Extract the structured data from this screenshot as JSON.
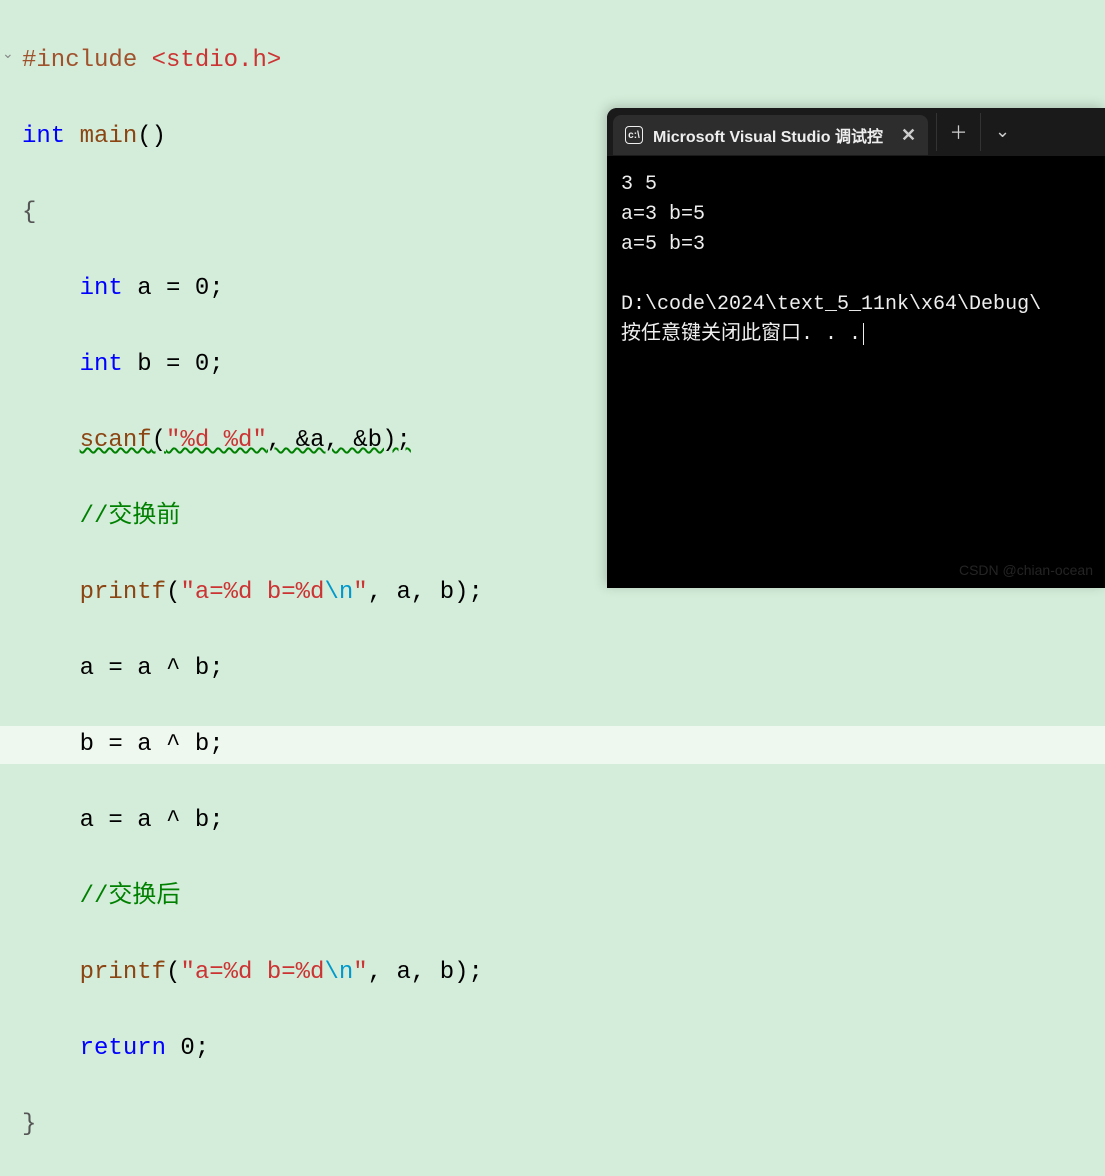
{
  "editor": {
    "include_directive": "#include",
    "include_header": "<stdio.h>",
    "kw_int": "int",
    "main": "main",
    "parens": "()",
    "lbrace": "{",
    "decl_a": "    int a = 0;",
    "decl_b": "    int b = 0;",
    "scanf_name": "scanf",
    "scanf_args_open": "(",
    "scanf_fmt": "\"%d %d\"",
    "scanf_rest": ", &a, &b);",
    "comment_before": "//交换前",
    "printf_name": "printf",
    "printf_open": "(",
    "printf_fmt1": "\"a=%d b=%d",
    "printf_esc": "\\n",
    "printf_fmt2": "\"",
    "printf_rest": ", a, b);",
    "xor1": "    a = a ^ b;",
    "xor2": "    b = a ^ b;",
    "xor3": "    a = a ^ b;",
    "comment_after": "//交换后",
    "return_kw": "return",
    "return_rest": " 0;",
    "rbrace": "}"
  },
  "terminal": {
    "tab_title": "Microsoft Visual Studio 调试控",
    "output_input": "3 5",
    "output_before": "a=3 b=5",
    "output_after": "a=5 b=3",
    "path": "D:\\code\\2024\\text_5_11nk\\x64\\Debug\\",
    "prompt": "按任意键关闭此窗口. . ."
  },
  "watermark": "CSDN @chian-ocean"
}
